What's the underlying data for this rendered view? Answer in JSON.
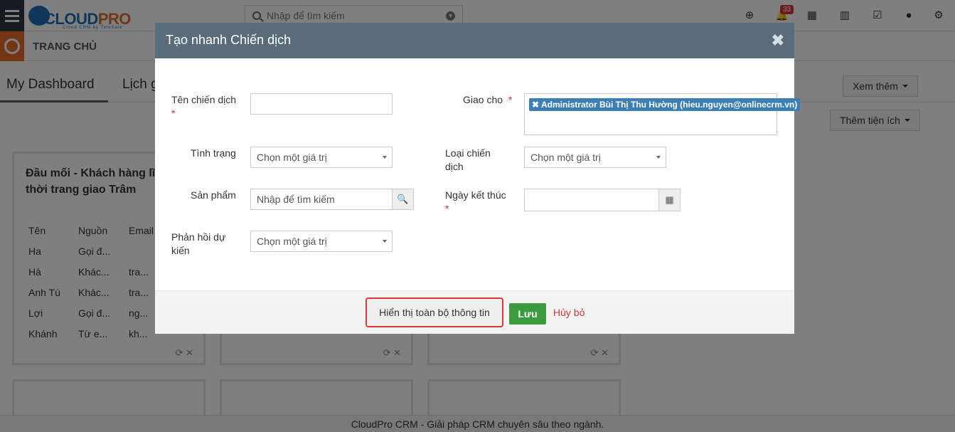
{
  "app": {
    "logo_text_main": "CLOUD",
    "logo_text_accent": "PRO",
    "logo_tagline": "Cloud CRM by TeleSale",
    "search_placeholder": "Nhập để tìm kiếm",
    "notification_count": "33"
  },
  "nav": {
    "home_label": "TRANG CHỦ"
  },
  "dashboard": {
    "tabs": [
      {
        "label": "My Dashboard"
      },
      {
        "label": "Lịch g"
      }
    ],
    "more_button": "Xem thêm",
    "add_widget_button": "Thêm tiện ích",
    "widget_title": "Đầu mối - Khách hàng lĩnh vực thời trang giao Trâm",
    "widget_table": {
      "headers": [
        "Tên",
        "Nguồn",
        "Email"
      ],
      "rows": [
        [
          "Ha",
          "Gọi đ...",
          ""
        ],
        [
          "Hà",
          "Khác...",
          "tra..."
        ],
        [
          "Anh Tú",
          "Khác...",
          "tra..."
        ],
        [
          "Lợi",
          "Gọi đ...",
          "ng..."
        ],
        [
          "Khánh",
          "Từ e...",
          "kh..."
        ]
      ]
    }
  },
  "footer_text": "CloudPro CRM - Giải pháp CRM chuyên sâu theo ngành.",
  "modal": {
    "title": "Tạo nhanh Chiến dịch",
    "close_symbol": "✖",
    "fields": {
      "campaign_name_label": "Tên chiến dịch",
      "campaign_name_value": "",
      "assigned_to_label": "Giao cho",
      "assigned_to_value": "Administrator Bùi Thị Thu Hường (hieu.nguyen@onlinecrm.vn)",
      "status_label": "Tình trạng",
      "status_value": "Chọn một giá trị",
      "campaign_type_label_1": "Loại chiến",
      "campaign_type_label_2": "dịch",
      "campaign_type_value": "Chọn một giá trị",
      "product_label": "Sản phẩm",
      "product_placeholder": "Nhập để tìm kiếm",
      "end_date_label": "Ngày kết thúc",
      "end_date_value": "",
      "expected_response_label_1": "Phản hồi dự",
      "expected_response_label_2": "kiến",
      "expected_response_value": "Chọn một giá trị",
      "required_mark": "*"
    },
    "buttons": {
      "show_full": "Hiển thị toàn bộ thông tin",
      "save": "Lưu",
      "cancel": "Hủy bỏ"
    }
  }
}
